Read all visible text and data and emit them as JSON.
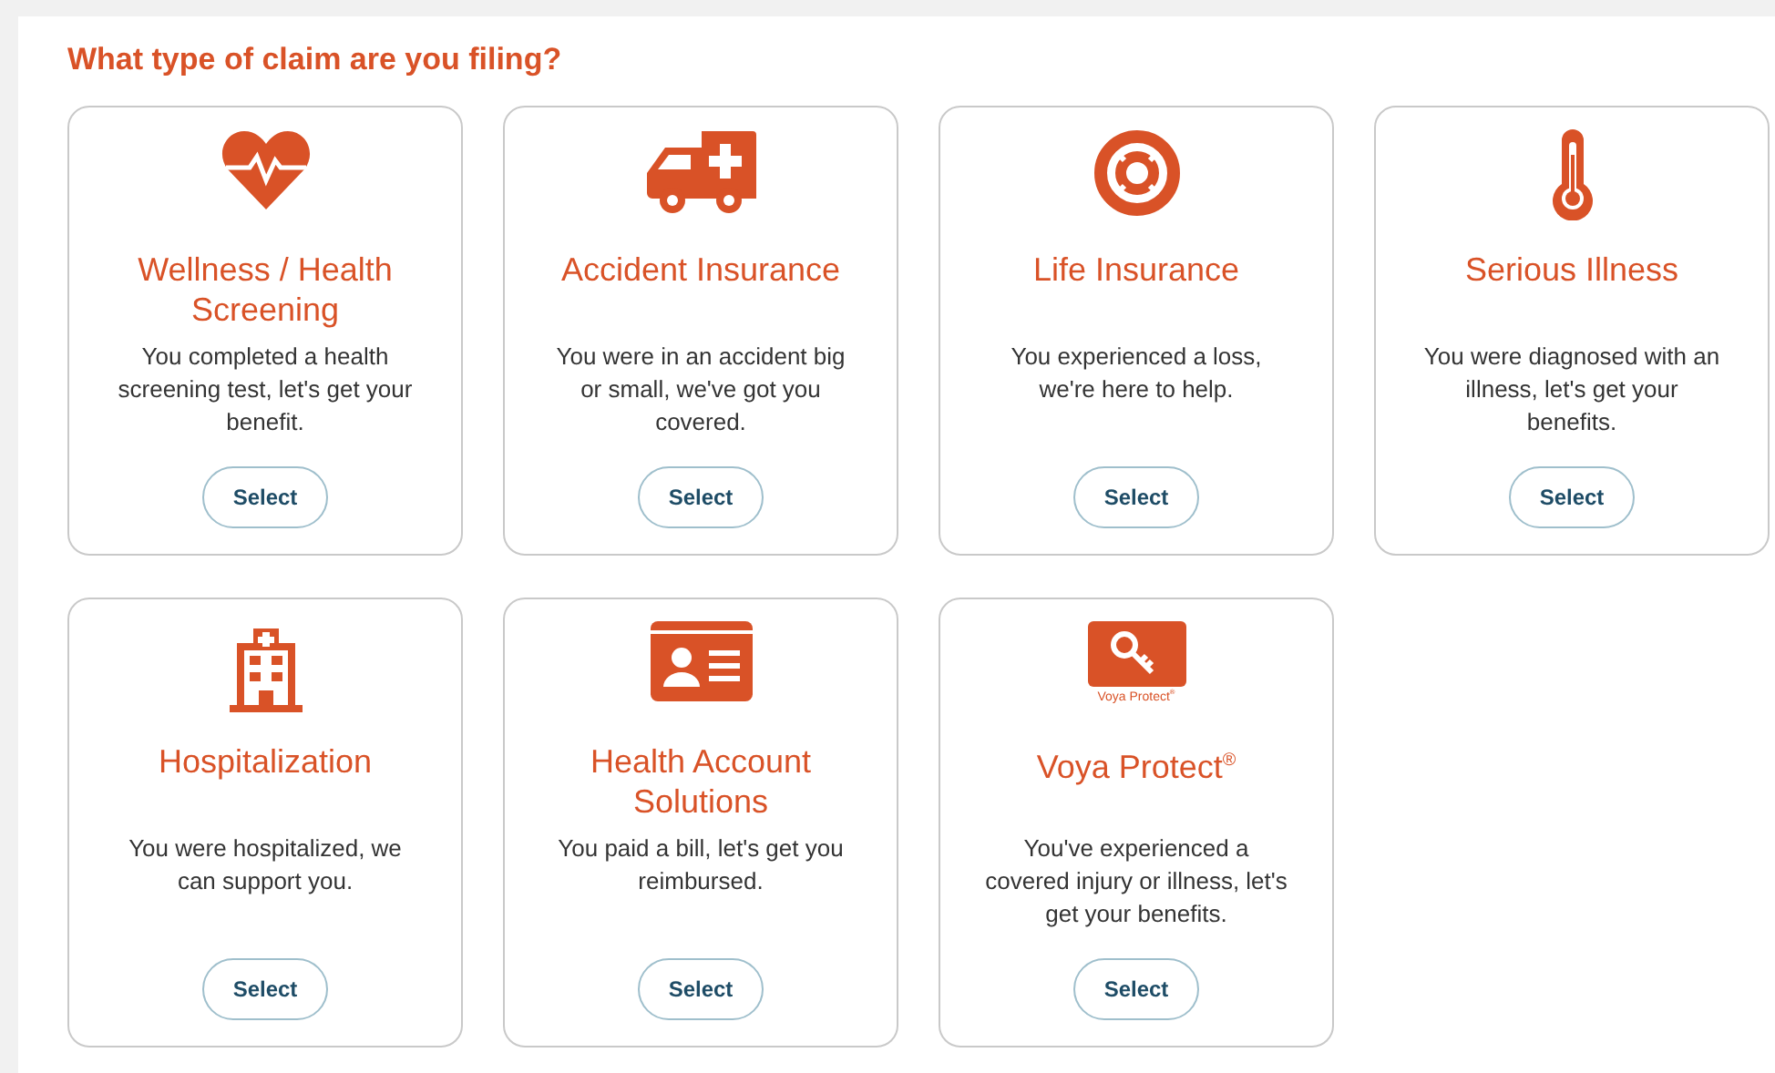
{
  "heading": "What type of claim are you filing?",
  "cards": [
    {
      "title": "Wellness / Health Screening",
      "description": "You completed a health screening test, let's get your benefit.",
      "button": "Select"
    },
    {
      "title": "Accident Insurance",
      "description": "You were in an accident big or small, we've got you covered.",
      "button": "Select"
    },
    {
      "title": "Life Insurance",
      "description": "You experienced a loss, we're here to help.",
      "button": "Select"
    },
    {
      "title": "Serious Illness",
      "description": "You were diagnosed with an illness, let's get your benefits.",
      "button": "Select"
    },
    {
      "title": "Hospitalization",
      "description": "You were hospitalized, we can support you.",
      "button": "Select"
    },
    {
      "title": "Health Account Solutions",
      "description": "You paid a bill, let's get you reimbursed.",
      "button": "Select"
    },
    {
      "icon_caption": "Voya Protect$^{®}$",
      "title": "Voya Protect$^{®}$",
      "description": "You've experienced a covered injury or illness, let's get your benefits.",
      "button": "Select"
    }
  ]
}
